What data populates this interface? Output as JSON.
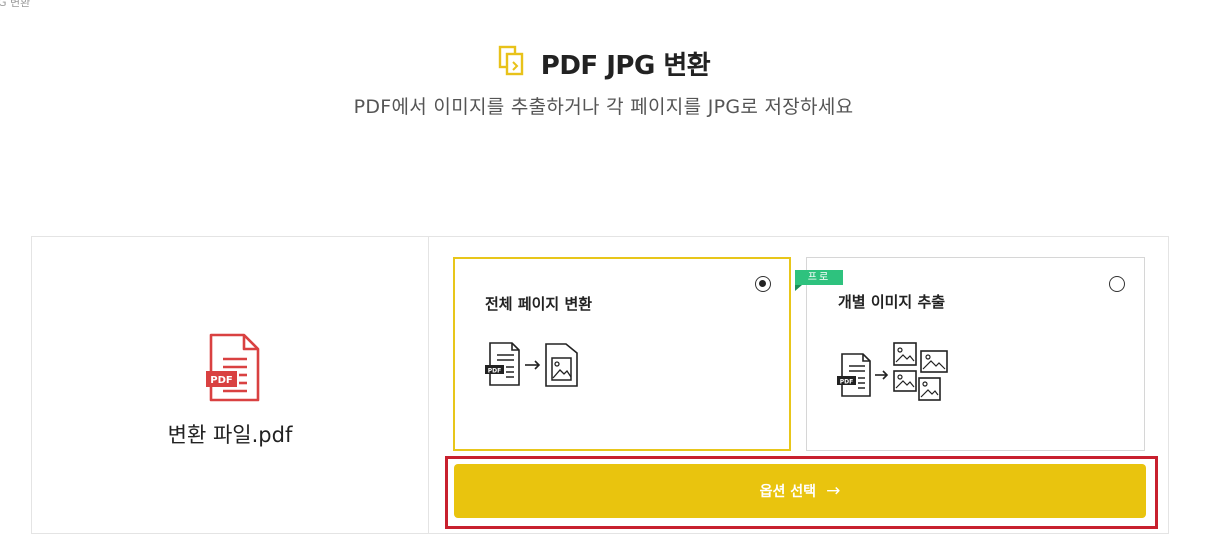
{
  "window": {
    "tab_title_fragment": "G 변환"
  },
  "header": {
    "title": "PDF JPG 변환",
    "subtitle": "PDF에서 이미지를 추출하거나 각 페이지를 JPG로 저장하세요",
    "title_icon": "copy-pages-icon"
  },
  "file": {
    "name": "변환 파일.pdf",
    "icon": "pdf-file-icon",
    "icon_badge": "PDF"
  },
  "options": [
    {
      "label": "전체 페이지 변환",
      "selected": true,
      "icon": "pdf-to-image-icon"
    },
    {
      "label": "개별 이미지 추출",
      "selected": false,
      "badge": "프로",
      "icon": "pdf-to-multiple-images-icon"
    }
  ],
  "cta": {
    "label": "옵션 선택",
    "arrow": "→"
  },
  "colors": {
    "accent": "#e9c40e",
    "selected_border": "#e8c61a",
    "pdf_red": "#d94141",
    "pro_badge": "#2ec27e",
    "highlight": "#c8202e"
  }
}
